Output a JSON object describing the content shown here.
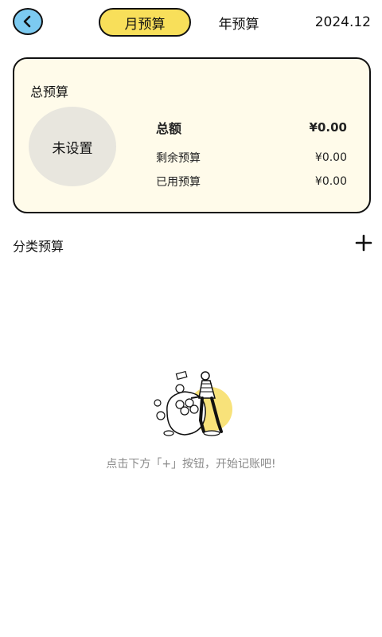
{
  "header": {
    "back_icon": "chevron-left-icon",
    "tab_month": "月预算",
    "tab_year": "年预算",
    "date": "2024.12",
    "accent_color": "#f8df5a",
    "back_color": "#7ccaf0"
  },
  "total_budget": {
    "title": "总预算",
    "circle_text": "未设置",
    "total_label": "总额",
    "total_value": "¥0.00",
    "remaining_label": "剩余预算",
    "remaining_value": "¥0.00",
    "used_label": "已用预算",
    "used_value": "¥0.00",
    "card_bg": "#fffbea"
  },
  "category_budget": {
    "title": "分类预算",
    "add_icon": "plus-icon"
  },
  "empty_state": {
    "illustration": "person-with-money-bag-illustration",
    "text": "点击下方「+」按钮，开始记账吧!"
  }
}
